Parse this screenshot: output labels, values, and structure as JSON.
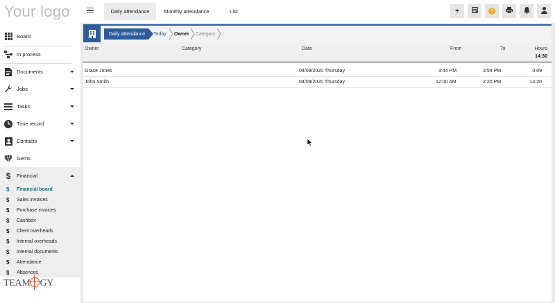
{
  "logo": {
    "text": "Your logo"
  },
  "sidebar": {
    "items": [
      {
        "label": "Board",
        "icon": "grid-icon"
      },
      {
        "label": "In process",
        "icon": "flow-icon"
      },
      {
        "label": "Documents",
        "icon": "document-icon"
      },
      {
        "label": "Jobs",
        "icon": "wrench-icon"
      },
      {
        "label": "Tasks",
        "icon": "tasks-icon"
      },
      {
        "label": "Time record",
        "icon": "clock-icon"
      },
      {
        "label": "Contacts",
        "icon": "contacts-icon"
      },
      {
        "label": "Gems",
        "icon": "gem-icon"
      },
      {
        "label": "Financial",
        "icon": "dollar-icon"
      }
    ],
    "financial_sub": [
      {
        "label": "Financial board"
      },
      {
        "label": "Sales invoices"
      },
      {
        "label": "Purchase invoices"
      },
      {
        "label": "Cashbox"
      },
      {
        "label": "Client overheads"
      },
      {
        "label": "Internal overheads"
      },
      {
        "label": "Internal documents"
      },
      {
        "label": "Attendance"
      },
      {
        "label": "Absences"
      }
    ],
    "brand": {
      "text_left": "TEAM",
      "text_right": "GY"
    }
  },
  "topbar": {
    "tabs": [
      {
        "label": "Daily attendance"
      },
      {
        "label": "Monthly attendance"
      },
      {
        "label": "List"
      }
    ],
    "tools": [
      {
        "icon": "plus-icon",
        "glyph": "+"
      },
      {
        "icon": "notes-icon",
        "glyph": "≡"
      },
      {
        "icon": "help-icon",
        "glyph": "?",
        "color": "#f5a623"
      },
      {
        "icon": "print-icon",
        "glyph": "⎙"
      },
      {
        "icon": "bell-icon",
        "glyph": "🔔"
      },
      {
        "icon": "user-icon",
        "glyph": "👤"
      }
    ]
  },
  "breadcrumb": {
    "items": [
      "Daily attendance",
      "Today",
      "Owner",
      "Category"
    ]
  },
  "table": {
    "headers": {
      "owner": "Owner",
      "category": "Category",
      "date": "Date",
      "from": "From",
      "to": "To",
      "hours": "Hours"
    },
    "total_hours": "14:30",
    "rows": [
      {
        "owner": "Grace Jones",
        "category": "",
        "date": "04/09/2020 Thursday",
        "from": "3:44 PM",
        "to": "3:54 PM",
        "hours": "0:09"
      },
      {
        "owner": "John Smith",
        "category": "",
        "date": "04/09/2020 Thursday",
        "from": "12:00 AM",
        "to": "2:20 PM",
        "hours": "14:20"
      }
    ]
  },
  "colors": {
    "accent": "#2e5c9a",
    "active_sub": "#1f6b78",
    "help": "#f5a623"
  }
}
